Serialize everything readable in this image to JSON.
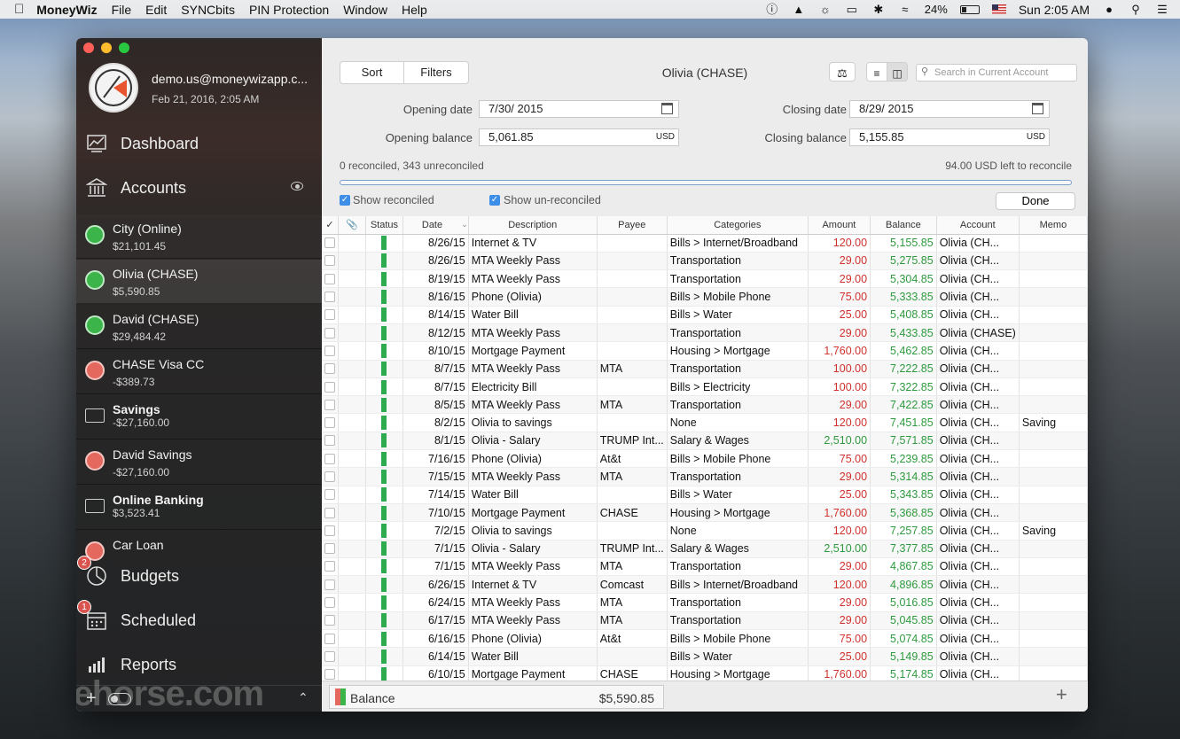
{
  "menubar": {
    "app": "MoneyWiz",
    "items": [
      "File",
      "Edit",
      "SYNCbits",
      "PIN Protection",
      "Window",
      "Help"
    ],
    "battery": "24%",
    "clock": "Sun 2:05 AM"
  },
  "sidebar": {
    "profile": {
      "email": "demo.us@moneywizapp.c...",
      "date": "Feb 21, 2016, 2:05 AM"
    },
    "nav": {
      "dashboard": "Dashboard",
      "accounts": "Accounts",
      "budgets": "Budgets",
      "scheduled": "Scheduled",
      "reports": "Reports"
    },
    "badges": {
      "budgets": "2",
      "scheduled": "1"
    },
    "accounts": [
      {
        "name": "City (Online)",
        "balance": "$21,101.45",
        "color": "#3bb54a"
      },
      {
        "name": "Olivia (CHASE)",
        "balance": "$5,590.85",
        "color": "#3bb54a"
      },
      {
        "name": "David (CHASE)",
        "balance": "$29,484.42",
        "color": "#3bb54a"
      },
      {
        "name": "CHASE Visa CC",
        "balance": "-$389.73",
        "color": "#e4685d"
      },
      {
        "name": "Savings",
        "balance": "-$27,160.00",
        "color": ""
      },
      {
        "name": "David Savings",
        "balance": "-$27,160.00",
        "color": "#e4685d"
      },
      {
        "name": "Online Banking",
        "balance": "$3,523.41",
        "color": ""
      },
      {
        "name": "Car Loan",
        "balance": "",
        "color": "#e4685d"
      }
    ],
    "watermark": "filehorse.com"
  },
  "toolbar": {
    "sort": "Sort",
    "filters": "Filters",
    "title": "Olivia (CHASE)",
    "search_placeholder": "Search in Current Account"
  },
  "reconcile": {
    "opening_date_label": "Opening date",
    "opening_date": "7/30/ 2015",
    "closing_date_label": "Closing date",
    "closing_date": "8/29/ 2015",
    "opening_balance_label": "Opening balance",
    "opening_balance": "5,061.85",
    "closing_balance_label": "Closing balance",
    "closing_balance": "5,155.85",
    "currency": "USD",
    "summary": "0 reconciled, 343 unreconciled",
    "left": "94.00 USD left to reconcile",
    "show_reconciled": "Show reconciled",
    "show_unreconciled": "Show un-reconciled",
    "done": "Done"
  },
  "table": {
    "headers": [
      "✓",
      "",
      "Status",
      "Date",
      "Description",
      "Payee",
      "Categories",
      "Amount",
      "Balance",
      "Account",
      "Memo"
    ],
    "rows": [
      [
        "8/26/15",
        "Internet & TV",
        "",
        "Bills > Internet/Broadband",
        "120.00",
        "5,155.85",
        "Olivia (CH...",
        ""
      ],
      [
        "8/26/15",
        "MTA Weekly Pass",
        "",
        "Transportation",
        "29.00",
        "5,275.85",
        "Olivia (CH...",
        ""
      ],
      [
        "8/19/15",
        "MTA Weekly Pass",
        "",
        "Transportation",
        "29.00",
        "5,304.85",
        "Olivia (CH...",
        ""
      ],
      [
        "8/16/15",
        "Phone (Olivia)",
        "",
        "Bills > Mobile Phone",
        "75.00",
        "5,333.85",
        "Olivia (CH...",
        ""
      ],
      [
        "8/14/15",
        "Water Bill",
        "",
        "Bills > Water",
        "25.00",
        "5,408.85",
        "Olivia (CH...",
        ""
      ],
      [
        "8/12/15",
        "MTA Weekly Pass",
        "",
        "Transportation",
        "29.00",
        "5,433.85",
        "Olivia (CHASE)",
        ""
      ],
      [
        "8/10/15",
        "Mortgage Payment",
        "",
        "Housing > Mortgage",
        "1,760.00",
        "5,462.85",
        "Olivia (CH...",
        ""
      ],
      [
        "8/7/15",
        "MTA Weekly Pass",
        "MTA",
        "Transportation",
        "100.00",
        "7,222.85",
        "Olivia (CH...",
        ""
      ],
      [
        "8/7/15",
        "Electricity Bill",
        "",
        "Bills > Electricity",
        "100.00",
        "7,322.85",
        "Olivia (CH...",
        ""
      ],
      [
        "8/5/15",
        "MTA Weekly Pass",
        "MTA",
        "Transportation",
        "29.00",
        "7,422.85",
        "Olivia (CH...",
        ""
      ],
      [
        "8/2/15",
        "Olivia to savings",
        "",
        "None",
        "120.00",
        "7,451.85",
        "Olivia (CH...",
        "Saving"
      ],
      [
        "8/1/15",
        "Olivia - Salary",
        "TRUMP Int...",
        "Salary & Wages",
        "2,510.00",
        "7,571.85",
        "Olivia (CH...",
        ""
      ],
      [
        "7/16/15",
        "Phone (Olivia)",
        "At&t",
        "Bills > Mobile Phone",
        "75.00",
        "5,239.85",
        "Olivia (CH...",
        ""
      ],
      [
        "7/15/15",
        "MTA Weekly Pass",
        "MTA",
        "Transportation",
        "29.00",
        "5,314.85",
        "Olivia (CH...",
        ""
      ],
      [
        "7/14/15",
        "Water Bill",
        "",
        "Bills > Water",
        "25.00",
        "5,343.85",
        "Olivia (CH...",
        ""
      ],
      [
        "7/10/15",
        "Mortgage Payment",
        "CHASE",
        "Housing > Mortgage",
        "1,760.00",
        "5,368.85",
        "Olivia (CH...",
        ""
      ],
      [
        "7/2/15",
        "Olivia to savings",
        "",
        "None",
        "120.00",
        "7,257.85",
        "Olivia (CH...",
        "Saving"
      ],
      [
        "7/1/15",
        "Olivia - Salary",
        "TRUMP Int...",
        "Salary & Wages",
        "2,510.00",
        "7,377.85",
        "Olivia (CH...",
        ""
      ],
      [
        "7/1/15",
        "MTA Weekly Pass",
        "MTA",
        "Transportation",
        "29.00",
        "4,867.85",
        "Olivia (CH...",
        ""
      ],
      [
        "6/26/15",
        "Internet & TV",
        "Comcast",
        "Bills > Internet/Broadband",
        "120.00",
        "4,896.85",
        "Olivia (CH...",
        ""
      ],
      [
        "6/24/15",
        "MTA Weekly Pass",
        "MTA",
        "Transportation",
        "29.00",
        "5,016.85",
        "Olivia (CH...",
        ""
      ],
      [
        "6/17/15",
        "MTA Weekly Pass",
        "MTA",
        "Transportation",
        "29.00",
        "5,045.85",
        "Olivia (CH...",
        ""
      ],
      [
        "6/16/15",
        "Phone (Olivia)",
        "At&t",
        "Bills > Mobile Phone",
        "75.00",
        "5,074.85",
        "Olivia (CH...",
        ""
      ],
      [
        "6/14/15",
        "Water Bill",
        "",
        "Bills > Water",
        "25.00",
        "5,149.85",
        "Olivia (CH...",
        ""
      ],
      [
        "6/10/15",
        "Mortgage Payment",
        "CHASE",
        "Housing > Mortgage",
        "1,760.00",
        "5,174.85",
        "Olivia (CH...",
        ""
      ]
    ],
    "income_rows": [
      11,
      17
    ]
  },
  "statusbar": {
    "label": "Balance",
    "value": "$5,590.85"
  },
  "colors": {
    "expense": "#d0312d",
    "income": "#2e9a3e",
    "balance": "#2e9a3e",
    "status": "#2eaa4f"
  }
}
